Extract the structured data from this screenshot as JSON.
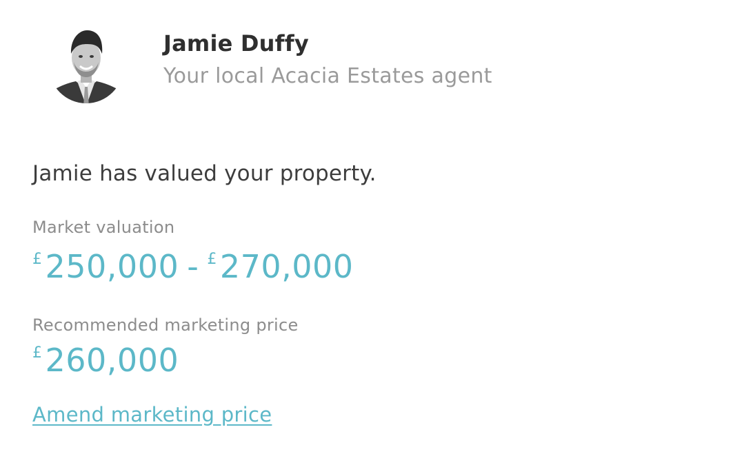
{
  "agent": {
    "name": "Jamie Duffy",
    "role": "Your local Acacia Estates agent"
  },
  "valuation": {
    "headline": "Jamie has valued your property.",
    "market_label": "Market valuation",
    "market_currency_low": "£",
    "market_low": "250,000",
    "market_separator": "-",
    "market_currency_high": "£",
    "market_high": "270,000",
    "recommended_label": "Recommended marketing price",
    "recommended_currency": "£",
    "recommended_price": "260,000"
  },
  "actions": {
    "amend_label": "Amend marketing price"
  },
  "colors": {
    "accent": "#5cb8c8",
    "text_dark": "#2f2f2f",
    "text_muted": "#9a9a9a"
  }
}
